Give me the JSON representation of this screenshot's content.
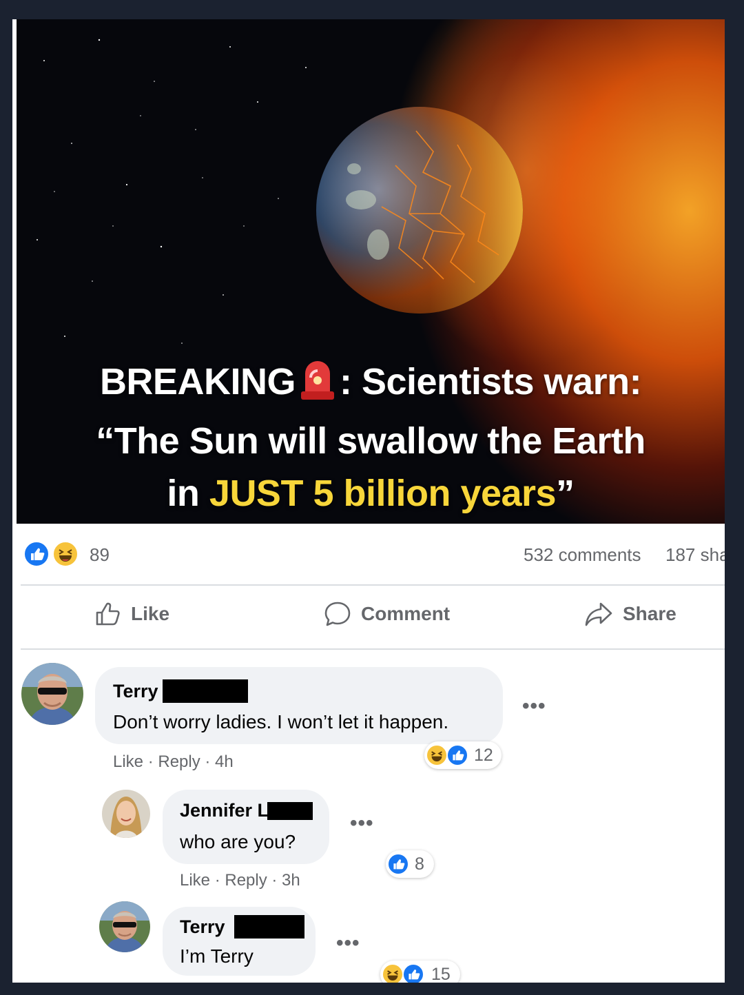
{
  "post": {
    "headline": {
      "line1_a": "BREAKING",
      "line1_b": ": Scientists warn:",
      "line2": "“The Sun will swallow the Earth",
      "line3_a": "in ",
      "line3_highlight": "JUST 5 billion years",
      "line3_b": "”"
    },
    "reaction_count": "89",
    "comments_count": "532 comments",
    "shares_count": "187 sha",
    "accent_color": "#1877f2",
    "highlight_color": "#f8d63a"
  },
  "actions": {
    "like": "Like",
    "comment": "Comment",
    "share": "Share"
  },
  "comments": [
    {
      "author": "Terry",
      "text": "Don’t worry ladies. I won’t let it happen.",
      "like": "Like",
      "sep1": " · ",
      "reply": "Reply",
      "sep2": " · ",
      "time": "4h",
      "reaction_count": "12",
      "more": "•••"
    },
    {
      "author": "Jennifer L",
      "text": "who are you?",
      "like": "Like",
      "sep1": " · ",
      "reply": "Reply",
      "sep2": " · ",
      "time": "3h",
      "reaction_count": "8",
      "more": "•••"
    },
    {
      "author": "Terry",
      "text": "I’m Terry",
      "reaction_count": "15",
      "more": "•••"
    }
  ]
}
